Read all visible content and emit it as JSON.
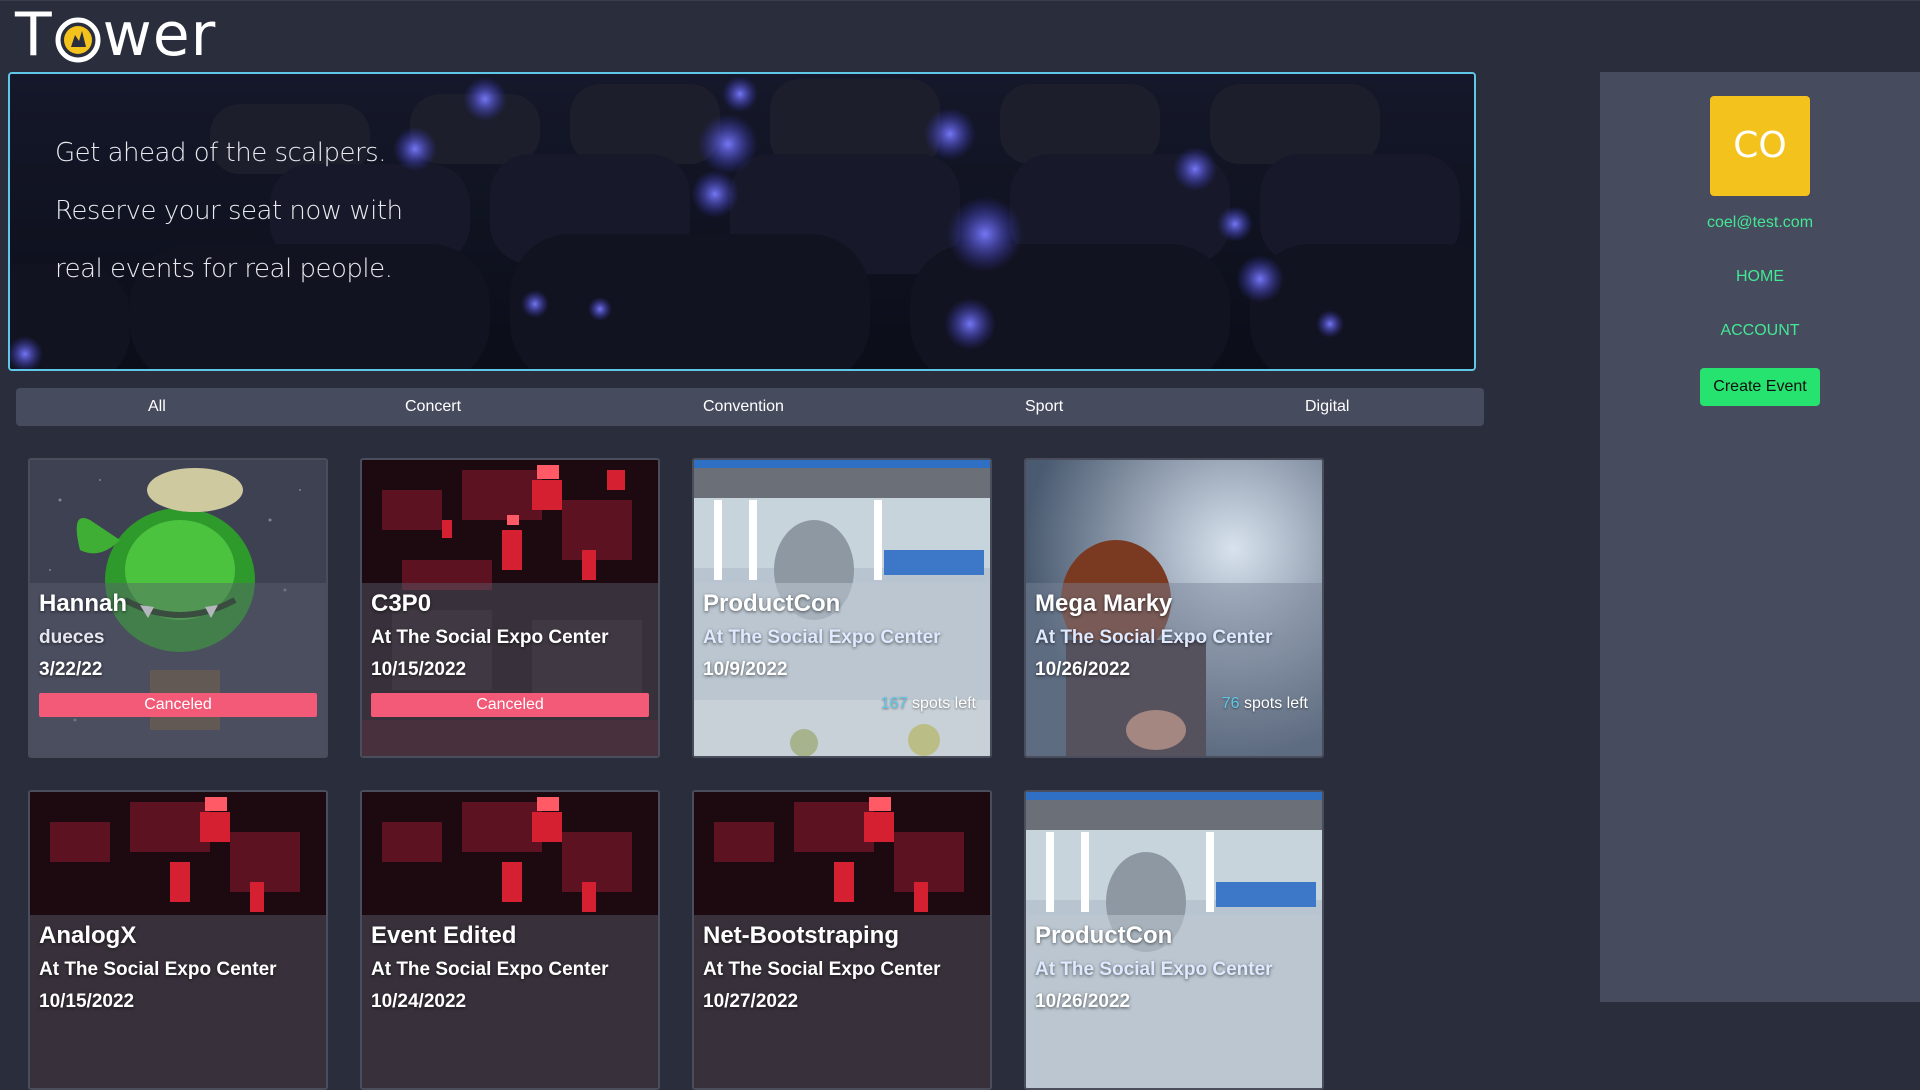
{
  "app": {
    "logo_text": "Tower",
    "logo_letters": {
      "t": "T",
      "rest": "wer"
    }
  },
  "hero": {
    "lines": [
      "Get ahead of the scalpers.",
      "Reserve your seat now with",
      "real events for real people."
    ]
  },
  "filters": [
    "All",
    "Concert",
    "Convention",
    "Sport",
    "Digital"
  ],
  "events": [
    {
      "name": "Hannah",
      "location": "dueces",
      "date": "3/22/22",
      "status": "Canceled",
      "spots": null,
      "image": "frog-toy"
    },
    {
      "name": "C3P0",
      "location": "At The Social Expo Center",
      "date": "10/15/2022",
      "status": "Canceled",
      "spots": null,
      "image": "red-circuit"
    },
    {
      "name": "ProductCon",
      "location": "At The Social Expo Center",
      "date": "10/9/2022",
      "status": null,
      "spots": "167",
      "image": "convention-building"
    },
    {
      "name": "Mega Marky",
      "location": "At The Social Expo Center",
      "date": "10/26/2022",
      "status": null,
      "spots": "76",
      "image": "singer-portrait"
    },
    {
      "name": "AnalogX",
      "location": "At The Social Expo Center",
      "date": "10/15/2022",
      "status": null,
      "spots": null,
      "image": "red-circuit"
    },
    {
      "name": "Event Edited",
      "location": "At The Social Expo Center",
      "date": "10/24/2022",
      "status": null,
      "spots": null,
      "image": "red-circuit"
    },
    {
      "name": "Net-Bootstraping",
      "location": "At The Social Expo Center",
      "date": "10/27/2022",
      "status": null,
      "spots": null,
      "image": "red-circuit"
    },
    {
      "name": "ProductCon",
      "location": "At The Social Expo Center",
      "date": "10/26/2022",
      "status": null,
      "spots": null,
      "image": "convention-building"
    }
  ],
  "spots_suffix": "spots left",
  "account": {
    "initials": "CO",
    "email": "coel@test.com",
    "home_label": "HOME",
    "account_label": "ACCOUNT",
    "create_label": "Create Event"
  },
  "colors": {
    "background": "#2a2d3c",
    "sidebar": "#474b5e",
    "accent_green": "#42e894",
    "button_green": "#26e26e",
    "avatar_yellow": "#f4c21c",
    "canceled_pink": "#f25a78",
    "hero_border": "#5fc8e8"
  }
}
